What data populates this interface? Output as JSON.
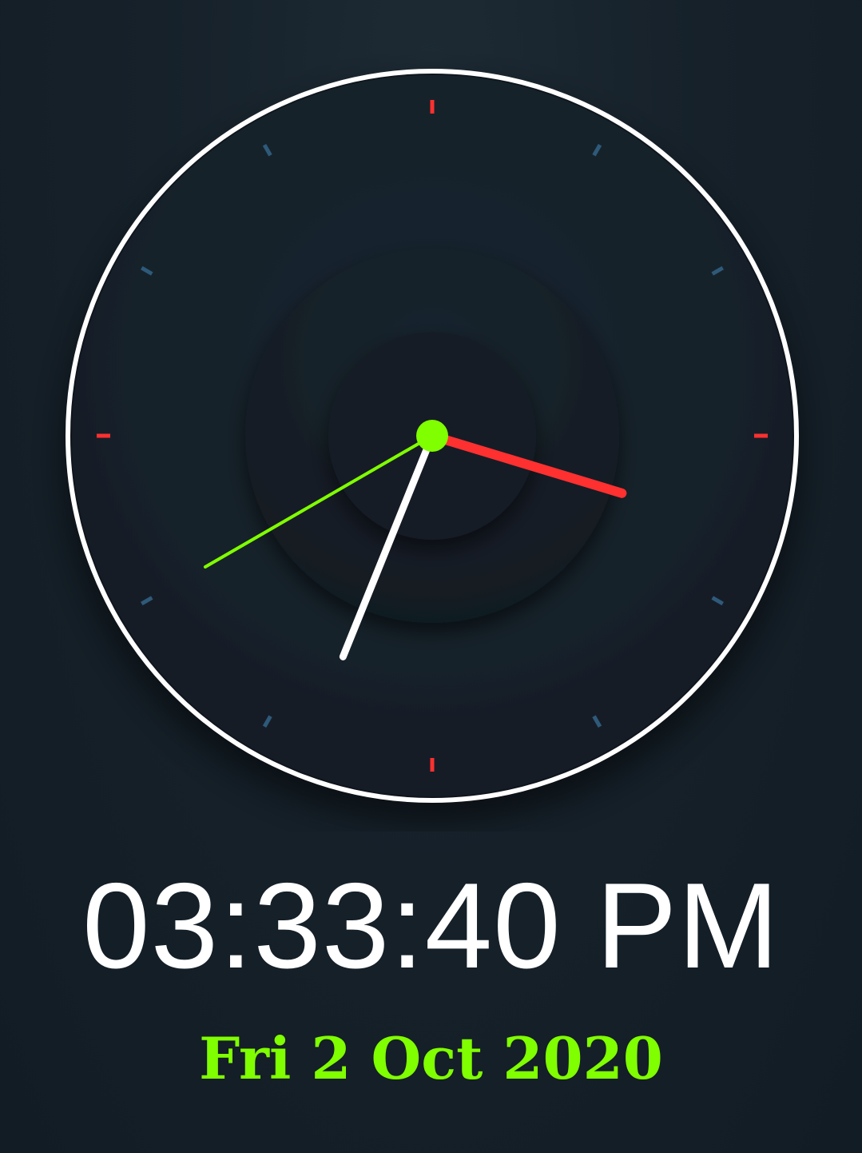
{
  "clock": {
    "time": {
      "hours": 15,
      "minutes": 33,
      "seconds": 40
    },
    "colors": {
      "face": "#15202a",
      "rim": "#ffffff",
      "hour_hand": "#ff3030",
      "minute_hand": "#ffffff",
      "second_hand": "#80ff00",
      "center_dot": "#80ff00",
      "quarter_ticks": "#ff3030",
      "hour_ticks": "#2e5a7a"
    }
  },
  "digital_time": "03:33:40 PM",
  "date": {
    "text": "Fri 2 Oct 2020",
    "color": "#80ff00"
  }
}
